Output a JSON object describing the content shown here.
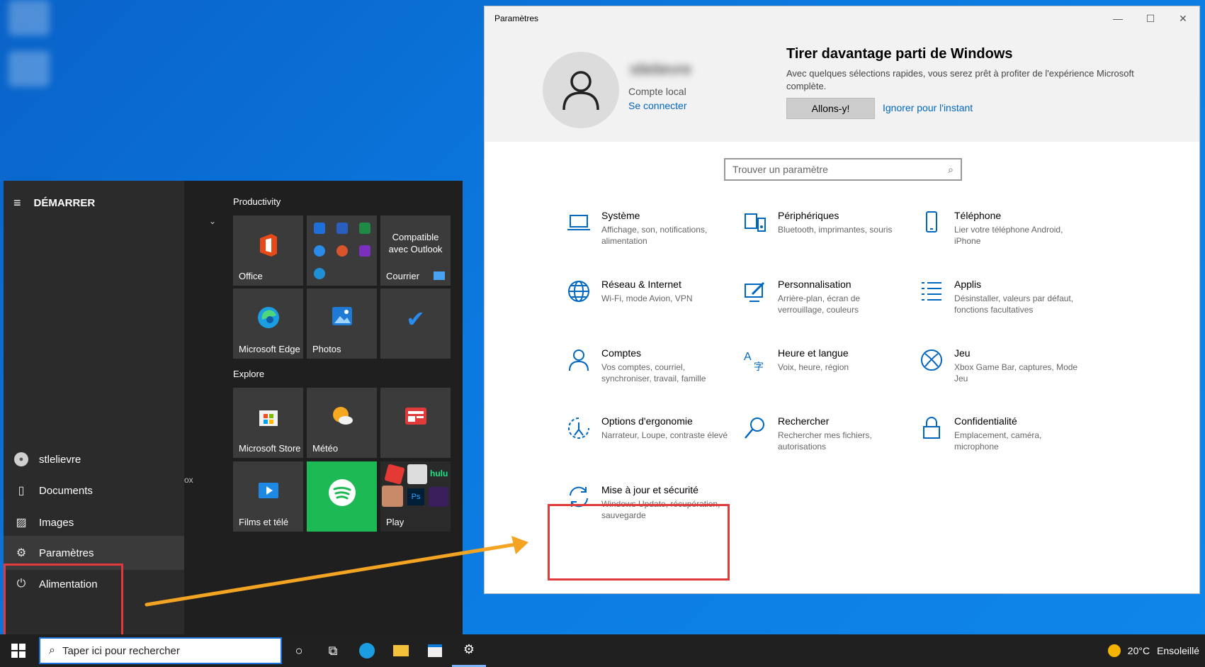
{
  "desktop": {
    "colors": {
      "accent": "#0b7ae0",
      "highlight": "#e03a3a",
      "arrow": "#f3a423"
    }
  },
  "start_menu": {
    "title": "DÉMARRER",
    "menu_icon": "hamburger-icon",
    "rail": [
      {
        "label": "stlelievre",
        "icon": "user-avatar-icon"
      },
      {
        "label": "Documents",
        "icon": "document-icon"
      },
      {
        "label": "Images",
        "icon": "picture-icon"
      },
      {
        "label": "Paramètres",
        "icon": "gear-icon"
      },
      {
        "label": "Alimentation",
        "icon": "power-icon"
      }
    ],
    "partial_label": "ox",
    "groups": [
      {
        "title": "Productivity"
      },
      {
        "title": "Explore"
      }
    ],
    "tiles": {
      "office": "Office",
      "outlook_compat": "Compatible avec Outlook",
      "courrier": "Courrier",
      "edge": "Microsoft Edge",
      "photos": "Photos",
      "store": "Microsoft Store",
      "meteo": "Météo",
      "films": "Films et télé",
      "play": "Play",
      "hulu": "hulu",
      "ps": "Ps"
    }
  },
  "taskbar": {
    "search_placeholder": "Taper ici pour rechercher",
    "temperature": "20°C",
    "weather": "Ensoleillé"
  },
  "settings": {
    "window_title": "Paramètres",
    "account": {
      "name": "stlelievre",
      "type": "Compte local",
      "signin": "Se connecter"
    },
    "promo": {
      "title": "Tirer davantage parti de Windows",
      "desc": "Avec quelques sélections rapides, vous serez prêt à profiter de l'expérience Microsoft complète.",
      "primary": "Allons-y!",
      "secondary": "Ignorer pour l'instant"
    },
    "search_placeholder": "Trouver un paramètre",
    "categories": [
      {
        "title": "Système",
        "desc": "Affichage, son, notifications, alimentation",
        "icon": "laptop-icon"
      },
      {
        "title": "Périphériques",
        "desc": "Bluetooth, imprimantes, souris",
        "icon": "devices-icon"
      },
      {
        "title": "Téléphone",
        "desc": "Lier votre téléphone Android, iPhone",
        "icon": "phone-icon"
      },
      {
        "title": "Réseau & Internet",
        "desc": "Wi-Fi, mode Avion, VPN",
        "icon": "globe-icon"
      },
      {
        "title": "Personnalisation",
        "desc": "Arrière-plan, écran de verrouillage, couleurs",
        "icon": "paint-icon"
      },
      {
        "title": "Applis",
        "desc": "Désinstaller, valeurs par défaut, fonctions facultatives",
        "icon": "apps-list-icon"
      },
      {
        "title": "Comptes",
        "desc": "Vos comptes, courriel, synchroniser, travail, famille",
        "icon": "person-icon"
      },
      {
        "title": "Heure et langue",
        "desc": "Voix, heure, région",
        "icon": "language-icon"
      },
      {
        "title": "Jeu",
        "desc": "Xbox Game Bar, captures, Mode Jeu",
        "icon": "xbox-icon"
      },
      {
        "title": "Options d'ergonomie",
        "desc": "Narrateur, Loupe, contraste élevé",
        "icon": "ease-of-access-icon"
      },
      {
        "title": "Rechercher",
        "desc": "Rechercher mes fichiers, autorisations",
        "icon": "search-icon"
      },
      {
        "title": "Confidentialité",
        "desc": "Emplacement, caméra, microphone",
        "icon": "lock-icon"
      },
      {
        "title": "Mise à jour et sécurité",
        "desc": "Windows Update, récupération, sauvegarde",
        "icon": "sync-icon"
      }
    ]
  }
}
